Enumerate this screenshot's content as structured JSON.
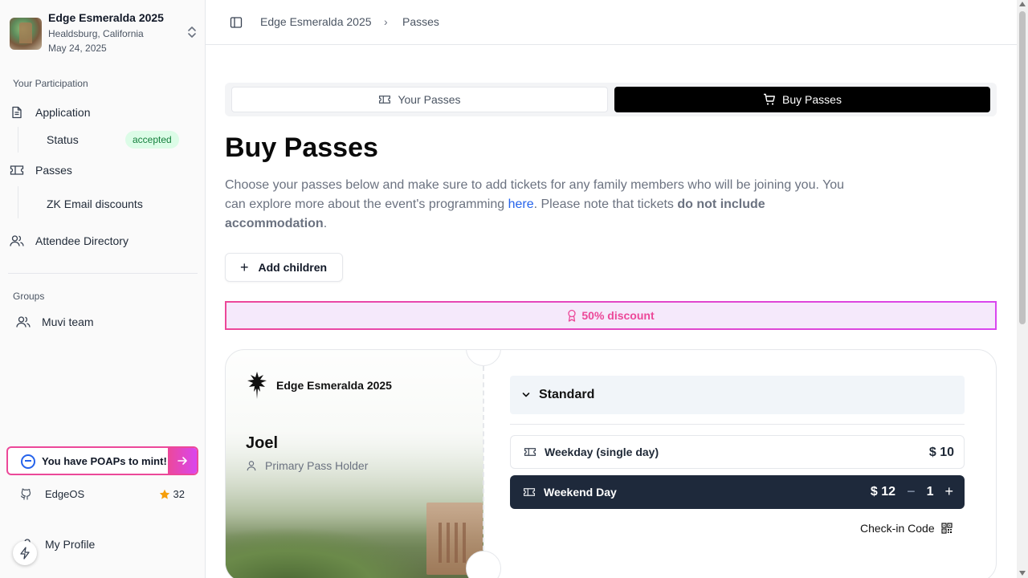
{
  "event": {
    "name": "Edge Esmeralda 2025",
    "location": "Healdsburg, California",
    "date": "May 24, 2025"
  },
  "sidebar": {
    "participation_label": "Your Participation",
    "application": "Application",
    "status_label": "Status",
    "status_badge": "accepted",
    "passes": "Passes",
    "zk_email": "ZK Email discounts",
    "attendee_directory": "Attendee Directory",
    "groups_label": "Groups",
    "group_item": "Muvi team",
    "poap_text": "You have POAPs to mint!",
    "edgeos_label": "EdgeOS",
    "edgeos_stars": "32",
    "profile_label": "My Profile"
  },
  "breadcrumb": {
    "root": "Edge Esmeralda 2025",
    "sep": "›",
    "current": "Passes"
  },
  "tabs": {
    "your_passes": "Your Passes",
    "buy_passes": "Buy Passes",
    "active": "buy_passes"
  },
  "main": {
    "title": "Buy Passes",
    "desc_part1": "Choose your passes below and make sure to add tickets for any family members who will be joining you. You can explore more about the event's programming ",
    "desc_link": "here",
    "desc_part2": ". Please note that tickets ",
    "desc_bold": "do not include accommodation",
    "desc_part3": ".",
    "add_children": "Add children",
    "discount": "50% discount"
  },
  "pass": {
    "event_name": "Edge Esmeralda 2025",
    "holder_name": "Joel",
    "holder_role": "Primary Pass Holder",
    "category": "Standard",
    "tickets": [
      {
        "name": "Weekday (single day)",
        "price": "$ 10",
        "selected": false
      },
      {
        "name": "Weekend Day",
        "price": "$ 12",
        "quantity": "1",
        "selected": true
      }
    ],
    "checkin_label": "Check-in Code"
  },
  "colors": {
    "accent_pink": "#ec4899",
    "accent_magenta": "#d946ef",
    "badge_green_bg": "#dcfce7",
    "badge_green_text": "#15803d",
    "selected_ticket_bg": "#1e293b",
    "active_tab_bg": "#000000",
    "link_blue": "#2563eb"
  }
}
